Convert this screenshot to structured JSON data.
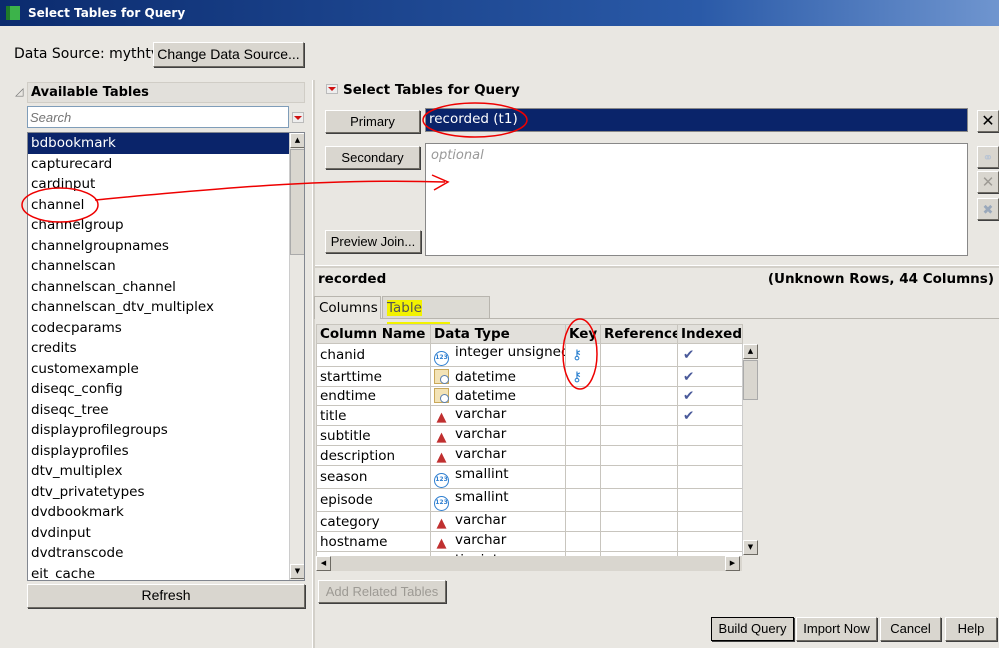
{
  "window": {
    "title": "Select Tables for Query"
  },
  "datasource": {
    "label": "Data Source: mythtv",
    "change_button": "Change Data Source..."
  },
  "available": {
    "title": "Available Tables",
    "search_placeholder": "Search",
    "refresh": "Refresh",
    "tables": [
      "bdbookmark",
      "capturecard",
      "cardinput",
      "channel",
      "channelgroup",
      "channelgroupnames",
      "channelscan",
      "channelscan_channel",
      "channelscan_dtv_multiplex",
      "codecparams",
      "credits",
      "customexample",
      "diseqc_config",
      "diseqc_tree",
      "displayprofilegroups",
      "displayprofiles",
      "dtv_multiplex",
      "dtv_privatetypes",
      "dvdbookmark",
      "dvdinput",
      "dvdtranscode",
      "eit_cache"
    ],
    "selected": "bdbookmark"
  },
  "select": {
    "title": "Select Tables for Query",
    "primary_button": "Primary",
    "primary_value": "recorded (t1)",
    "secondary_button": "Secondary",
    "secondary_placeholder": "optional",
    "preview_join": "Preview Join..."
  },
  "detail": {
    "table_name": "recorded",
    "summary": "(Unknown Rows, 44 Columns)",
    "tabs": [
      "Columns",
      "Table Snapshot"
    ],
    "headers": [
      "Column Name",
      "Data Type",
      "Key",
      "Reference",
      "Indexed"
    ],
    "rows": [
      {
        "name": "chanid",
        "type": "integer unsigned",
        "icon": "numeric",
        "key": true,
        "indexed": true
      },
      {
        "name": "starttime",
        "type": "datetime",
        "icon": "datetime",
        "key": true,
        "indexed": true
      },
      {
        "name": "endtime",
        "type": "datetime",
        "icon": "datetime",
        "key": false,
        "indexed": true
      },
      {
        "name": "title",
        "type": "varchar",
        "icon": "character",
        "key": false,
        "indexed": true
      },
      {
        "name": "subtitle",
        "type": "varchar",
        "icon": "character",
        "key": false,
        "indexed": false
      },
      {
        "name": "description",
        "type": "varchar",
        "icon": "character",
        "key": false,
        "indexed": false
      },
      {
        "name": "season",
        "type": "smallint",
        "icon": "numeric",
        "key": false,
        "indexed": false
      },
      {
        "name": "episode",
        "type": "smallint",
        "icon": "numeric",
        "key": false,
        "indexed": false
      },
      {
        "name": "category",
        "type": "varchar",
        "icon": "character",
        "key": false,
        "indexed": false
      },
      {
        "name": "hostname",
        "type": "varchar",
        "icon": "character",
        "key": false,
        "indexed": false
      },
      {
        "name": "bookmark",
        "type": "tinyint",
        "icon": "numeric",
        "key": false,
        "indexed": false
      }
    ],
    "add_related": "Add Related Tables"
  },
  "footer": {
    "build_query": "Build Query",
    "import_now": "Import Now",
    "cancel": "Cancel",
    "help": "Help"
  }
}
